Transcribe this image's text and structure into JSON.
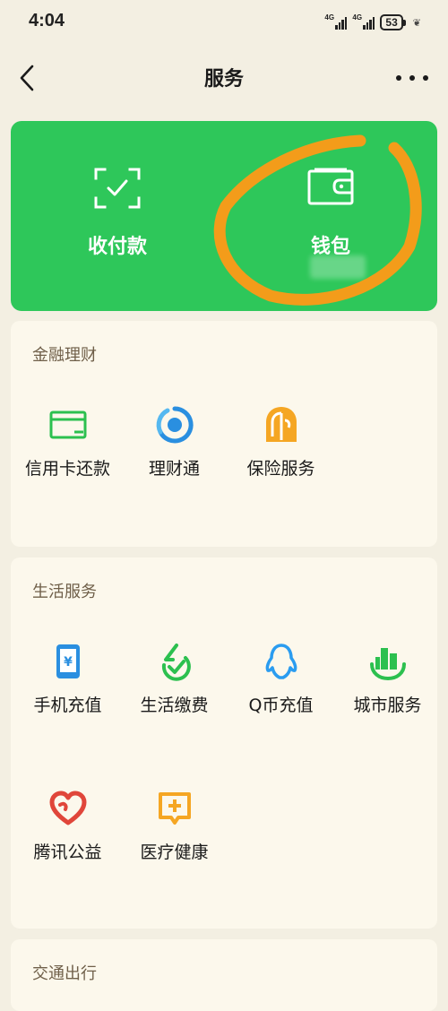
{
  "status_bar": {
    "time": "4:04",
    "signal1_label": "4G",
    "signal2_label": "4G",
    "battery_level": "53"
  },
  "nav": {
    "title": "服务"
  },
  "hero": {
    "pay_label": "收付款",
    "wallet_label": "钱包",
    "accent_color": "#2ec75a",
    "annotation_color": "#f39c1a"
  },
  "finance": {
    "title": "金融理财",
    "items": [
      {
        "label": "信用卡还款",
        "icon": "credit-card-icon"
      },
      {
        "label": "理财通",
        "icon": "wealth-icon"
      },
      {
        "label": "保险服务",
        "icon": "insurance-icon"
      }
    ]
  },
  "life": {
    "title": "生活服务",
    "items": [
      {
        "label": "手机充值",
        "icon": "phone-topup-icon"
      },
      {
        "label": "生活缴费",
        "icon": "utility-bill-icon"
      },
      {
        "label": "Q币充值",
        "icon": "qq-penguin-icon"
      },
      {
        "label": "城市服务",
        "icon": "city-service-icon"
      },
      {
        "label": "腾讯公益",
        "icon": "charity-heart-icon"
      },
      {
        "label": "医疗健康",
        "icon": "medical-icon"
      }
    ]
  },
  "transport": {
    "title": "交通出行"
  }
}
